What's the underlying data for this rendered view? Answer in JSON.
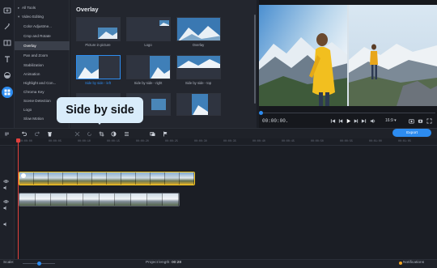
{
  "tools": {
    "items": [
      {
        "label": "All Tools",
        "header": true,
        "caret": "▸"
      },
      {
        "label": "Video Editing",
        "header": true,
        "caret": "▾"
      },
      {
        "label": "Color Adjustme..."
      },
      {
        "label": "Crop and Rotate"
      },
      {
        "label": "Overlay",
        "active": true
      },
      {
        "label": "Pan and Zoom"
      },
      {
        "label": "Stabilization"
      },
      {
        "label": "Animation"
      },
      {
        "label": "Highlight and Con..."
      },
      {
        "label": "Chroma Key"
      },
      {
        "label": "Scene Detection"
      },
      {
        "label": "Logo"
      },
      {
        "label": "Slow Motion"
      }
    ]
  },
  "gallery": {
    "title": "Overlay",
    "thumbs": [
      {
        "label": "Picture in picture"
      },
      {
        "label": "Logo"
      },
      {
        "label": "Overlay"
      },
      {
        "label": "Side by side - left",
        "selected": true
      },
      {
        "label": "Side by side - right"
      },
      {
        "label": "Side by side - top"
      },
      {
        "label": ""
      },
      {
        "label": ""
      },
      {
        "label": ""
      }
    ]
  },
  "tooltip": {
    "text": "Side by side"
  },
  "preview": {
    "timecode": "00:00:00.",
    "aspect": "16:9 ▾",
    "progress": 0.0
  },
  "timeline": {
    "export_label": "Export",
    "ruler": [
      "00:00:00",
      "00:00:05",
      "00:00:10",
      "00:00:15",
      "00:00:20",
      "00:00:25",
      "00:00:30",
      "00:00:35",
      "00:00:40",
      "00:00:45",
      "00:00:50",
      "00:00:55",
      "00:01:00",
      "00:01:05",
      "00:01:10",
      "00:01:15",
      "00:01:20",
      "00:01:25",
      "00:01:30",
      "00:01:35"
    ]
  },
  "status": {
    "scale_label": "Scale:",
    "scale_value": 0.5,
    "project_length_label": "Project length:",
    "project_length_value": "00:28",
    "notifications_label": "Notifications"
  },
  "colors": {
    "accent": "#2d8cf0",
    "selection": "#f3c623",
    "playhead": "#e0403d"
  }
}
